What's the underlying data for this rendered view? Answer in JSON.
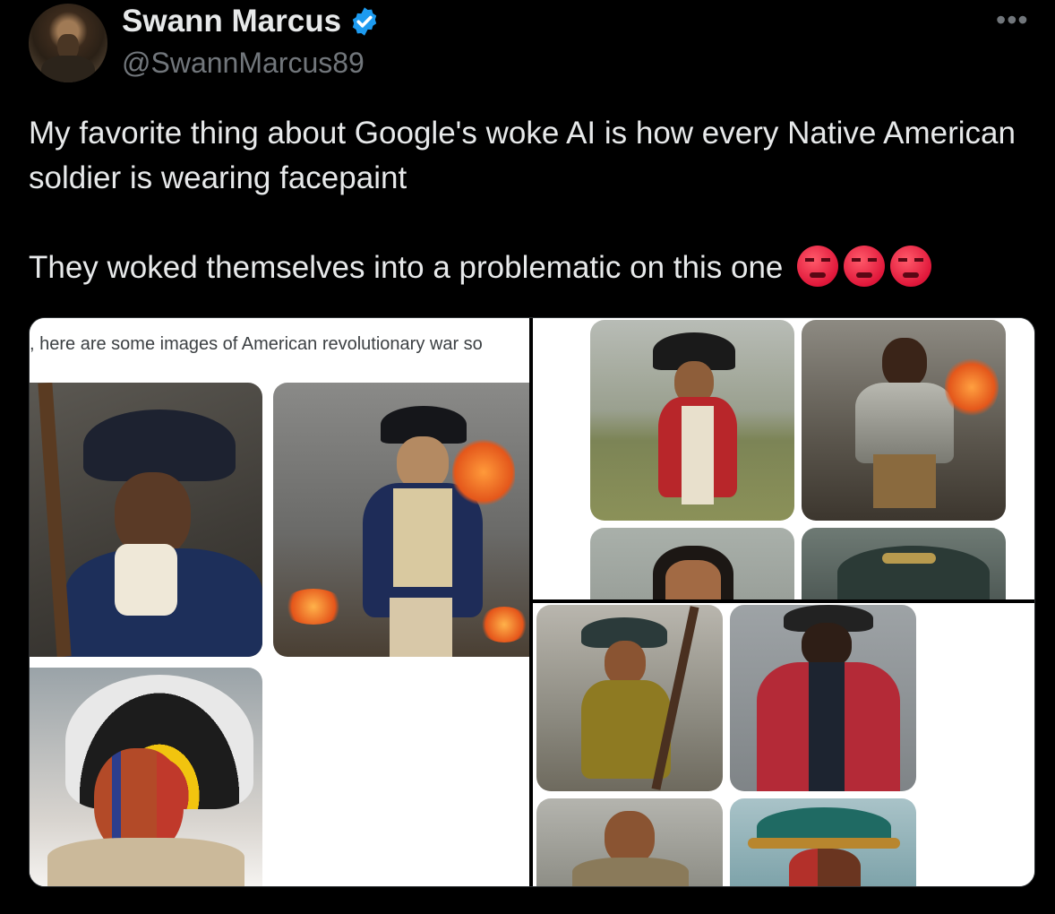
{
  "author": {
    "name": "Swann Marcus",
    "handle": "@SwannMarcus89",
    "verified": true
  },
  "tweet": {
    "line1": "My favorite thing about Google's woke AI is how every Native American soldier is wearing facepaint",
    "line2": "They woked themselves into a problematic on this one",
    "emojis": [
      "pouting-face",
      "pouting-face",
      "pouting-face"
    ]
  },
  "media": {
    "caption": ", here are some images of American revolutionary war so"
  },
  "colors": {
    "background": "#000000",
    "text": "#e7e9ea",
    "muted": "#71767b",
    "verified": "#1d9bf0"
  }
}
